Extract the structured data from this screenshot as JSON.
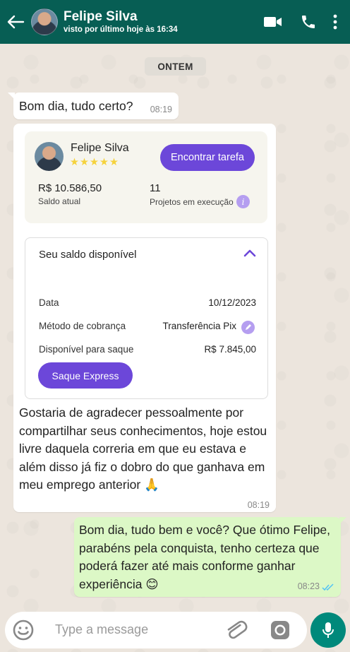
{
  "header": {
    "contact_name": "Felipe Silva",
    "last_seen": "visto por último hoje às 16:34",
    "icons": [
      "back-arrow-icon",
      "video-call-icon",
      "phone-icon",
      "more-vert-icon"
    ]
  },
  "date_separator": "ONTEM",
  "messages": [
    {
      "direction": "in",
      "text": "Bom dia, tudo certo?",
      "time": "08:19"
    },
    {
      "direction": "in",
      "card": {
        "name": "Felipe Silva",
        "rating_stars": 5,
        "stars_text": "★★★★★",
        "find_task_label": "Encontrar tarefa",
        "balance_value": "R$ 10.586,50",
        "balance_label": "Saldo atual",
        "projects_value": "11",
        "projects_label": "Projetos em execução",
        "available_title": "Seu saldo disponível",
        "rows": [
          {
            "label": "Data",
            "value": "10/12/2023"
          },
          {
            "label": "Método de cobrança",
            "value": "Transferência Pix"
          },
          {
            "label": "Disponível para saque",
            "value": "R$ 7.845,00"
          }
        ],
        "express_label": "Saque Express"
      },
      "text": "Gostaria de agradecer pessoalmente por compartilhar seus conhecimentos, hoje estou livre daquela correria em que eu estava e além disso já fiz o dobro do que ganhava em meu emprego anterior 🙏",
      "time": "08:19"
    },
    {
      "direction": "out",
      "text": "Bom dia, tudo bem e você? Que ótimo Felipe, parabéns pela conquista, tenho certeza que poderá fazer até mais conforme ganhar experiência 😊",
      "time": "08:23",
      "status": "read"
    }
  ],
  "composer": {
    "placeholder": "Type a message",
    "icons": [
      "emoji-icon",
      "attach-icon",
      "camera-icon",
      "mic-icon"
    ]
  },
  "colors": {
    "header": "#075e54",
    "outgoing_bubble": "#dcf8c6",
    "accent_purple": "#6c47d9",
    "mic_button": "#00897b",
    "read_ticks": "#4fc3f7"
  }
}
